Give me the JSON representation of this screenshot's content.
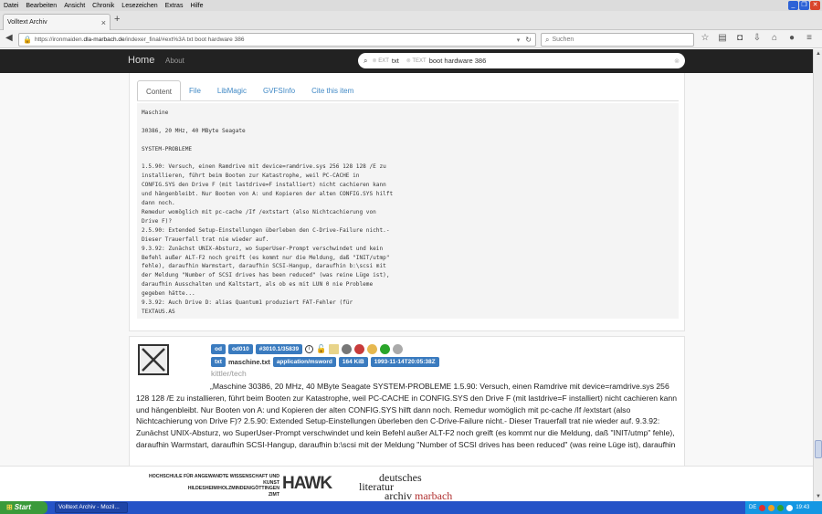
{
  "browser": {
    "menu": [
      "Datei",
      "Bearbeiten",
      "Ansicht",
      "Chronik",
      "Lesezeichen",
      "Extras",
      "Hilfe"
    ],
    "tab_title": "Volltext Archiv",
    "new_tab": "+",
    "url_prefix": "https://ironmaiden.",
    "url_host": "dla-marbach.de",
    "url_rest": "/indexer_final/#ext%3A txt boot hardware 386",
    "search_placeholder": "Suchen"
  },
  "site": {
    "brand": "Home",
    "about": "About",
    "query": {
      "token1_prefix": "EXT",
      "token1_value": "txt",
      "token2_prefix": "TEXT",
      "token2_value": "boot hardware 386",
      "clear": "⊗"
    },
    "tabs": [
      "Content",
      "File",
      "LibMagic",
      "GVFSInfo",
      "Cite this item"
    ],
    "content_lines": [
      "Maschine",
      "",
      "30386, 20 MHz, 40 MByte Seagate",
      "",
      "SYSTEM-PROBLEME",
      "",
      "1.5.90: Versuch, einen Ramdrive mit device=ramdrive.sys 256 128 128 /E zu",
      "installieren, führt beim Booten zur Katastrophe, weil PC-CACHE in",
      "CONFIG.SYS den Drive F (mit lastdrive=F installiert) nicht cachieren kann",
      "und hängenbleibt. Nur Booten von A: und Kopieren der alten CONFIG.SYS hilft",
      "dann noch.",
      "Remedur womöglich mit pc-cache /If /extstart (also Nichtcachierung von",
      "Drive F)?",
      "2.5.90: Extended Setup-Einstellungen überleben den C-Drive-Failure nicht.-",
      "Dieser Trauerfall trat nie wieder auf.",
      "9.3.92: Zunächst UNIX-Absturz, wo SuperUser-Prompt verschwindet und kein",
      "Befehl außer ALT-F2 noch greift (es kommt nur die Meldung, daß \"INIT/utmp\"",
      "fehle), daraufhin Warmstart, daraufhin SCSI-Hangup, daraufhin b:\\scsi mit",
      "der Meldung \"Number of SCSI drives has been reduced\" (was reine Lüge ist),",
      "daraufhin Ausschalten und Kaltstart, als ob es mit LUN 0 nie Probleme",
      "gegeben hätte...",
      "9.3.92: Auch Drive D: alias Quantum1 produziert FAT-Fehler (für",
      "TEXTAUS.AS"
    ],
    "result": {
      "labels_row1": [
        "od",
        "od010",
        "#3010.1/35839"
      ],
      "type_label": "txt",
      "filename": "maschine.txt",
      "labels_row2": [
        "application/msword",
        "164 KiB",
        "1993-11-14T20:05:38Z"
      ],
      "path": "kittler/tech",
      "snippet": "„Maschine 30386, 20 MHz, 40 MByte Seagate SYSTEM-PROBLEME 1.5.90: Versuch, einen Ramdrive mit device=ramdrive.sys 256 128 128 /E zu installieren, führt beim Booten zur Katastrophe, weil PC-CACHE in CONFIG.SYS den Drive F (mit lastdrive=F installiert) nicht cachieren kann und hängenbleibt. Nur Booten von A: und Kopieren der alten CONFIG.SYS hilft dann noch. Remedur womöglich mit pc-cache /If /extstart (also Nichtcachierung von Drive F)? 2.5.90: Extended Setup-Einstellungen überleben den C-Drive-Failure nicht.- Dieser Trauerfall trat nie wieder auf. 9.3.92: Zunächst UNIX-Absturz, wo SuperUser-Prompt verschwindet und kein Befehl außer ALT-F2 noch greift (es kommt nur die Meldung, daß \"INIT/utmp\" fehle), daraufhin Warmstart, daraufhin SCSI-Hangup, daraufhin b:\\scsi mit der Meldung \"Number of SCSI drives has been reduced\" (was reine Lüge ist), daraufhin"
    },
    "footer": {
      "hawk_line1": "HOCHSCHULE FÜR ANGEWANDTE WISSENSCHAFT UND KUNST",
      "hawk_line2": "HILDESHEIM/HOLZMINDEN/GÖTTINGEN",
      "hawk_line3": "ZIMT",
      "hawk_logo": "HAWK",
      "dla_line1": "deutsches",
      "dla_line2": "literatur",
      "dla_line3a": "archiv",
      "dla_line3b": "marbach"
    }
  },
  "taskbar": {
    "start": "Start",
    "window": "Volltext Archiv - Mozil...",
    "lang": "DE",
    "clock": "19:43"
  },
  "colors": {
    "label_blue": "#3a7bbf",
    "site_nav": "#222222",
    "link": "#3f88c5",
    "start_green": "#3a9a3a",
    "taskbar_blue": "#2553c7"
  }
}
